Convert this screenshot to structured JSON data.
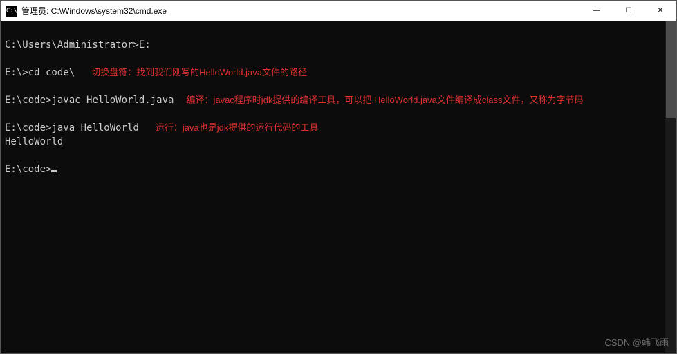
{
  "titlebar": {
    "icon_text": "C:\\",
    "title": "管理员: C:\\Windows\\system32\\cmd.exe"
  },
  "window_controls": {
    "minimize": "—",
    "maximize": "☐",
    "close": "✕"
  },
  "terminal": {
    "line1": {
      "prompt": "C:\\Users\\Administrator>",
      "command": "E:"
    },
    "line2": {
      "prompt": "E:\\>",
      "command": "cd code\\",
      "annotation": "切换盘符：找到我们刚写的HelloWorld.java文件的路径"
    },
    "line3": {
      "prompt": "E:\\code>",
      "command": "javac HelloWorld.java",
      "annotation": "编译：javac程序时jdk提供的编译工具，可以把.HelloWorld.java文件编译成class文件，又称为字节码"
    },
    "line4": {
      "prompt": "E:\\code>",
      "command": "java HelloWorld",
      "annotation": "运行：java也是jdk提供的运行代码的工具"
    },
    "output": "HelloWorld",
    "line5": {
      "prompt": "E:\\code>"
    }
  },
  "watermark": "CSDN @韩飞雨"
}
